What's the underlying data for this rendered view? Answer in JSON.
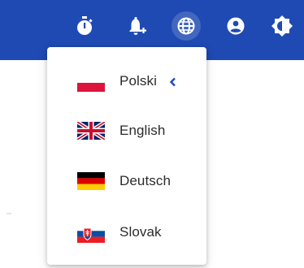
{
  "toolbar": {
    "icons": [
      "stopwatch-icon",
      "notification-bell-add-icon",
      "globe-icon",
      "account-circle-icon",
      "theme-brightness-icon"
    ]
  },
  "colors": {
    "header": "#1f4ab3",
    "accent": "#1f4ab3",
    "text": "#2b2b2b"
  },
  "language_menu": {
    "items": [
      {
        "label": "Polski",
        "flag": "poland-flag",
        "selected": true
      },
      {
        "label": "English",
        "flag": "united-kingdom-flag",
        "selected": false
      },
      {
        "label": "Deutsch",
        "flag": "germany-flag",
        "selected": false
      },
      {
        "label": "Slovak",
        "flag": "slovakia-flag",
        "selected": false
      }
    ]
  }
}
